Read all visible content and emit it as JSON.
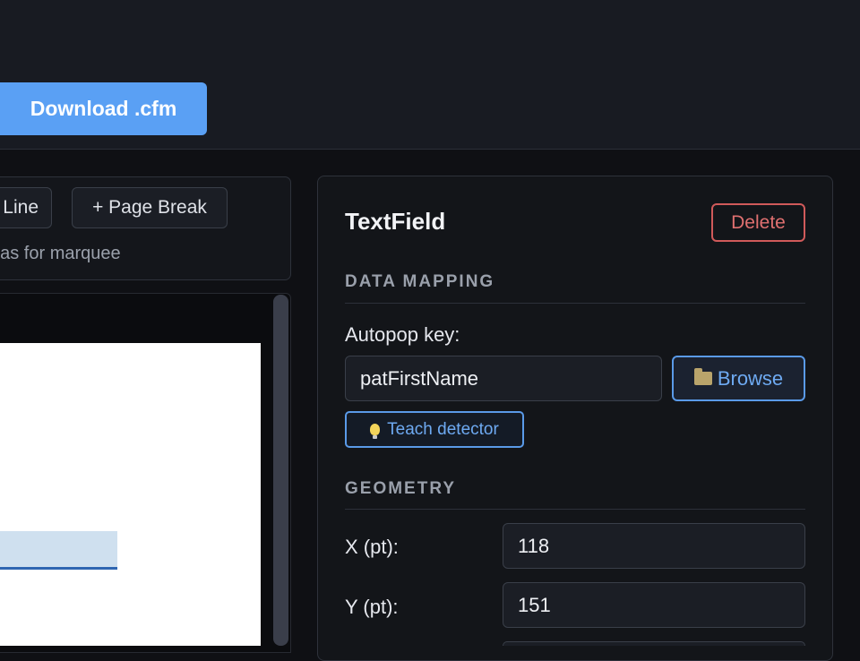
{
  "header": {
    "download_label": "Download .cfm"
  },
  "toolbar": {
    "line_label": "Line",
    "page_break_label": "+ Page Break",
    "hint_text": "nvas for marquee"
  },
  "inspector": {
    "title": "TextField",
    "delete_label": "Delete",
    "data_mapping": {
      "section_title": "DATA MAPPING",
      "autopop_label": "Autopop key:",
      "autopop_value": "patFirstName",
      "browse_label": "Browse",
      "teach_label": "Teach detector"
    },
    "geometry": {
      "section_title": "GEOMETRY",
      "x_label": "X (pt):",
      "x_value": "118",
      "y_label": "Y (pt):",
      "y_value": "151"
    }
  },
  "icons": {
    "browse": "folder-icon",
    "teach": "lightbulb-icon"
  },
  "colors": {
    "accent": "#5aa0f4",
    "danger": "#d05a5a",
    "field_highlight": "#cfe0ef"
  }
}
